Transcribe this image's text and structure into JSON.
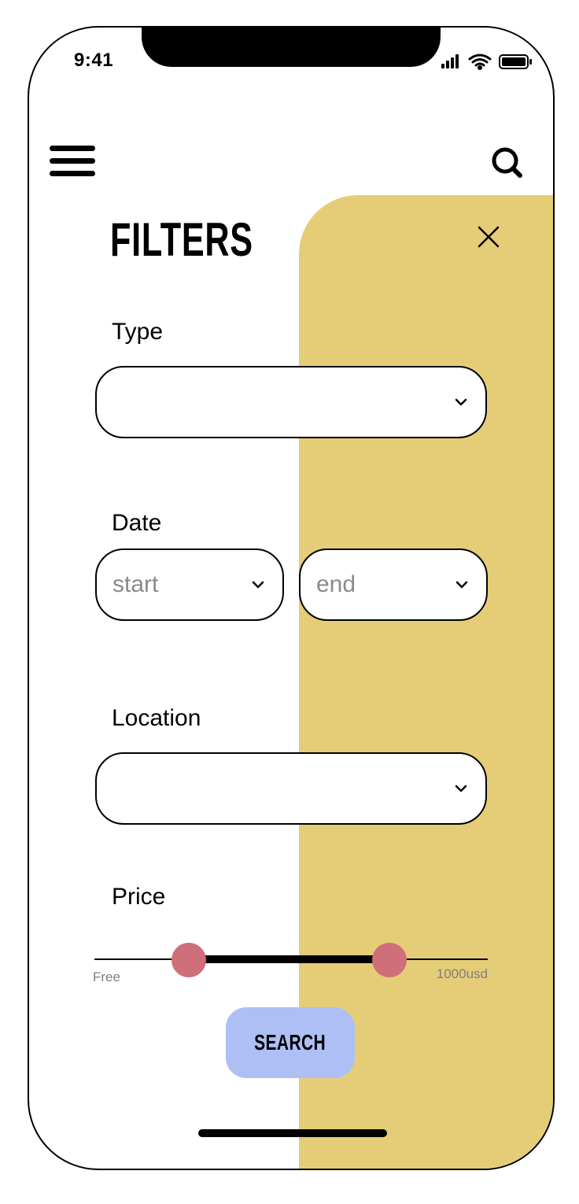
{
  "status_bar": {
    "time": "9:41",
    "icons": [
      "signal-icon",
      "wifi-icon",
      "battery-icon"
    ]
  },
  "header": {
    "menu_icon": "menu-icon",
    "search_icon": "search-icon"
  },
  "filters": {
    "title": "FILTERS",
    "close_icon": "close-icon",
    "type": {
      "label": "Type",
      "value": ""
    },
    "date": {
      "label": "Date",
      "start_placeholder": "start",
      "end_placeholder": "end"
    },
    "location": {
      "label": "Location",
      "value": ""
    },
    "price": {
      "label": "Price",
      "min_label": "Free",
      "max_label": "1000usd",
      "range_low_fraction": 0.24,
      "range_high_fraction": 0.75
    },
    "search_label": "SEARCH"
  },
  "colors": {
    "panel": "#E5CD78",
    "slider_handle": "#CE6F7A",
    "search_button": "#AEBFF5"
  }
}
